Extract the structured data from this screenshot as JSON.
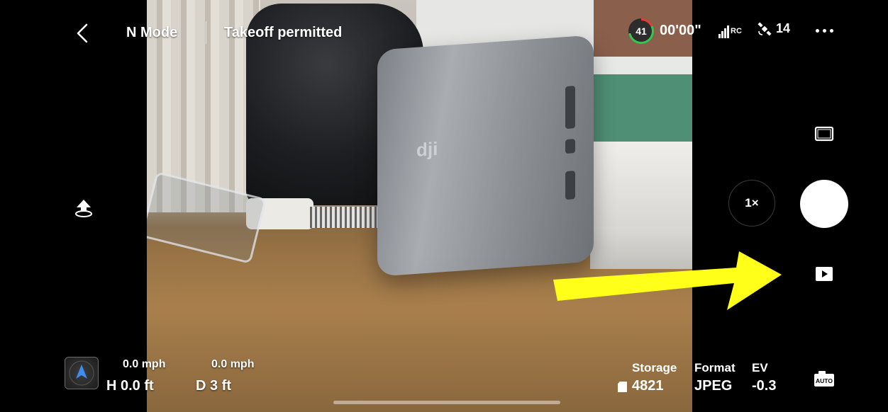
{
  "topbar": {
    "flight_mode": "N Mode",
    "takeoff_status": "Takeoff permitted",
    "battery_percent": "41",
    "flight_time": "00'00\"",
    "rc_label": "RC",
    "gps_count": "14"
  },
  "feed": {
    "logo_text": "dji"
  },
  "telemetry": {
    "vertical_speed": "0.0 mph",
    "horizontal_speed": "0.0 mph",
    "height": "H 0.0 ft",
    "distance": "D 3 ft"
  },
  "camera": {
    "zoom_label": "1×",
    "auto_label": "AUTO",
    "storage_label": "Storage",
    "storage_value": "4821",
    "format_label": "Format",
    "format_value": "JPEG",
    "ev_label": "EV",
    "ev_value": "-0.3"
  },
  "icons": {
    "back": "chevron-left-icon",
    "battery": "battery-ring-icon",
    "signal": "signal-bars-icon",
    "gps": "satellite-icon",
    "more": "more-dots-icon",
    "takeoff": "takeoff-icon",
    "radar": "attitude-radar-icon",
    "aspect": "aspect-ratio-icon",
    "playback": "playback-icon",
    "camera_mode": "camera-auto-icon",
    "storage": "sd-card-icon"
  },
  "colors": {
    "annotation_arrow": "#ffff1a",
    "battery_green": "#31c852",
    "battery_red": "#e23c36"
  }
}
